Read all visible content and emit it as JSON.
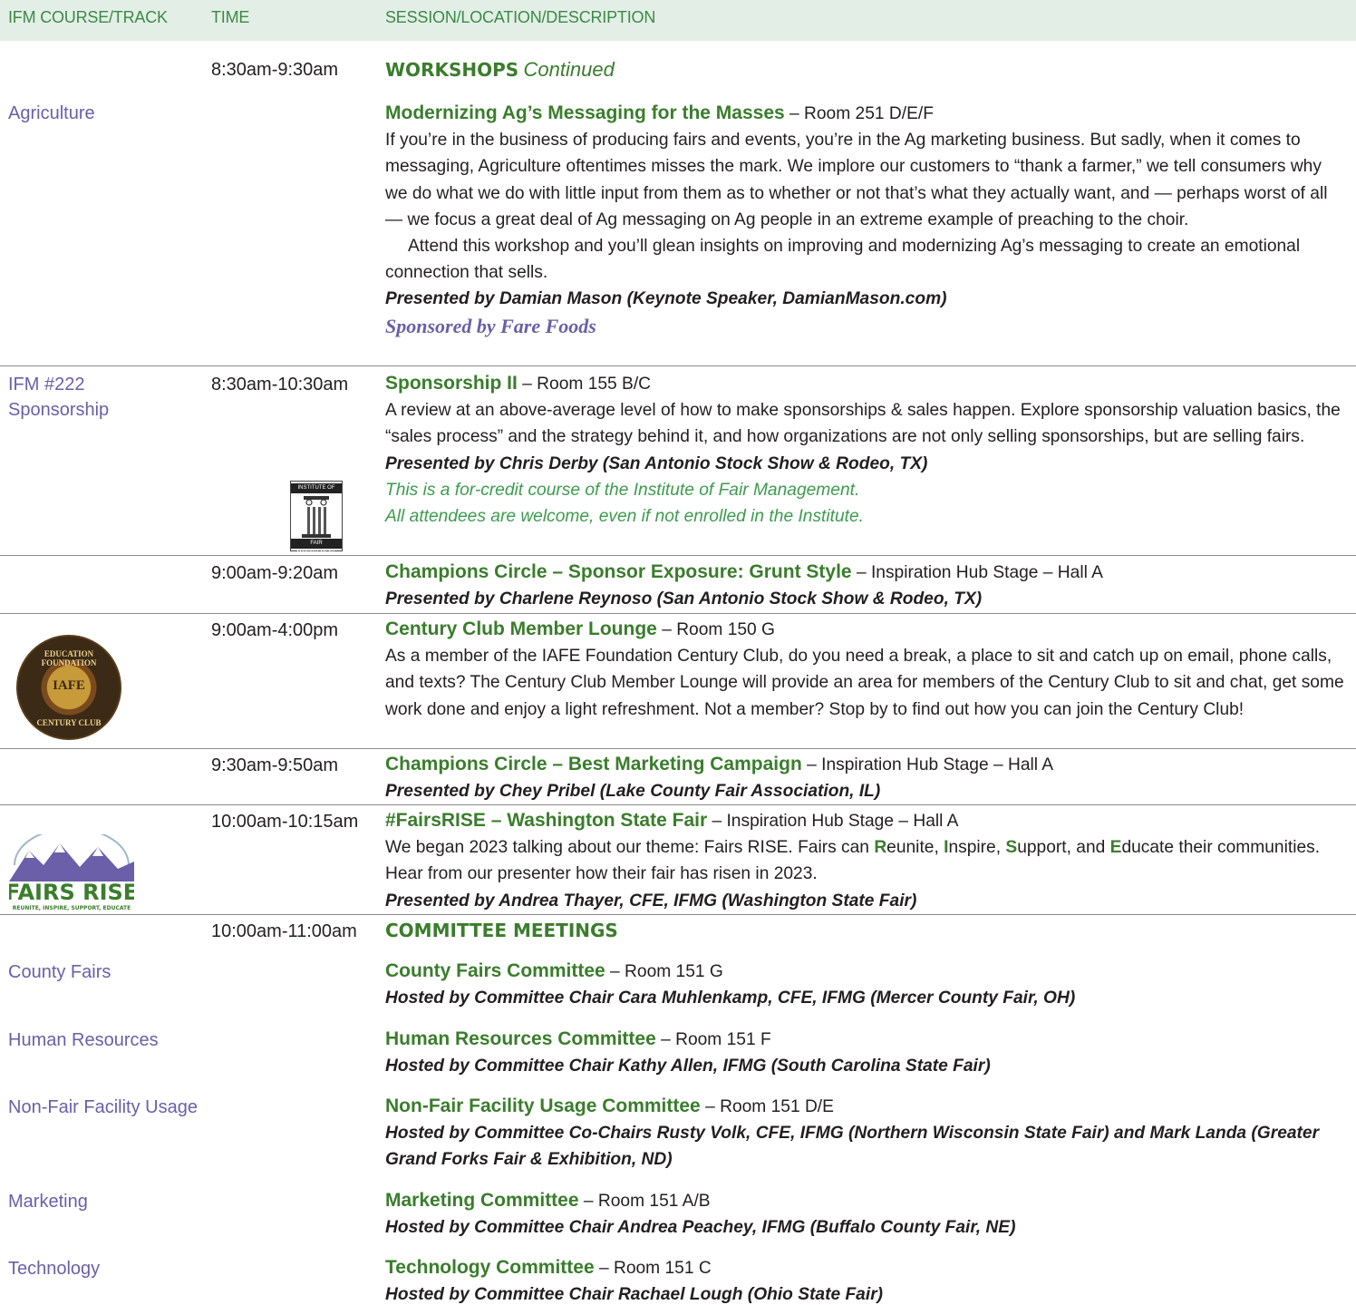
{
  "header": {
    "col1": "IFM COURSE/TRACK",
    "col2": "TIME",
    "col3": "SESSION/LOCATION/DESCRIPTION"
  },
  "workshops": {
    "time": "8:30am-9:30am",
    "heading": "WORKSHOPS",
    "heading_cont": "Continued",
    "track": "Agriculture",
    "title": "Modernizing Ag’s Messaging for the Masses",
    "location": " – Room 251 D/E/F",
    "body1": "If you’re in the business of producing fairs and events, you’re in the Ag marketing business. But sadly, when it comes to messaging, Agriculture oftentimes misses the mark. We implore our customers to “thank a farmer,” we tell consumers why we do what we do with little input from them as to whether or not that’s what they actually want, and — perhaps worst of all — we focus a great deal of Ag messaging on Ag people in an extreme example of preaching to the choir.",
    "body2": "Attend this workshop and you’ll glean insights on improving and modernizing Ag’s messaging to create an emotional connection that sells.",
    "presenter": "Presented by Damian Mason (Keynote Speaker, DamianMason.com)",
    "sponsor": "Sponsored by Fare Foods"
  },
  "sponsorship": {
    "track1": "IFM #222",
    "track2": "Sponsorship",
    "time": "8:30am-10:30am",
    "title": "Sponsorship II",
    "location": " – Room 155 B/C",
    "body": "A review at an above-average level of how to make sponsorships & sales happen. Explore sponsorship valuation basics, the “sales process” and the strategy behind it, and how organizations are not only selling sponsorships, but are selling fairs.",
    "presenter": "Presented by Chris Derby (San Antonio Stock Show & Rodeo, TX)",
    "credit1": "This is a for-credit course of the Institute of Fair Management.",
    "credit2": "All attendees are welcome, even if not enrolled in the Institute.",
    "logo_top": "INSTITUTE OF",
    "logo_bottom": "FAIR MANAGEMENT"
  },
  "grunt": {
    "time": "9:00am-9:20am",
    "title": "Champions Circle – Sponsor Exposure: Grunt Style",
    "location": " – Inspiration Hub Stage – Hall A",
    "presenter": "Presented by Charlene Reynoso (San Antonio Stock Show & Rodeo, TX)"
  },
  "century": {
    "time": "9:00am-4:00pm",
    "title": "Century Club Member Lounge",
    "location": " – Room 150 G",
    "body": "As a member of the IAFE Foundation Century Club, do you need a break, a place to sit and catch up on email, phone calls, and texts? The Century Club Member Lounge will provide an area for members of the Century Club to sit and chat, get some work done and enjoy a light refreshment. Not a member? Stop by to find out how you can join the Century Club!",
    "logo_top": "EDUCATION FOUNDATION",
    "logo_mid": "IAFE",
    "logo_bottom": "CENTURY CLUB"
  },
  "marketing_campaign": {
    "time": "9:30am-9:50am",
    "title": "Champions Circle – Best Marketing Campaign",
    "location": " – Inspiration Hub Stage – Hall A",
    "presenter": "Presented by Chey Pribel (Lake County Fair Association, IL)"
  },
  "fairsrise": {
    "time": "10:00am-10:15am",
    "title": "#FairsRISE – Washington State Fair",
    "location": " – Inspiration Hub Stage – Hall A",
    "body_a": "We began 2023 talking about our theme: Fairs RISE. Fairs can ",
    "r": "R",
    "r_rest": "eunite, ",
    "i": "I",
    "i_rest": "nspire, ",
    "s": "S",
    "s_rest": "upport, and ",
    "e": "E",
    "e_rest": "ducate their communities. Hear from our presenter how their fair has risen in 2023.",
    "presenter": "Presented by Andrea Thayer, CFE, IFMG (Washington State Fair)",
    "logo_text": "FAIRS RISE",
    "logo_sub": "REUNITE, INSPIRE, SUPPORT, EDUCATE"
  },
  "committees": {
    "time": "10:00am-11:00am",
    "heading": "COMMITTEE MEETINGS",
    "items": [
      {
        "track": "County Fairs",
        "title": "County Fairs Committee",
        "location": " – Room 151 G",
        "host": "Hosted by Committee Chair Cara Muhlenkamp, CFE, IFMG (Mercer County Fair, OH)"
      },
      {
        "track": "Human Resources",
        "title": "Human Resources Committee",
        "location": " – Room 151 F",
        "host": "Hosted by Committee Chair Kathy Allen, IFMG (South Carolina State Fair)"
      },
      {
        "track": "Non-Fair Facility Usage",
        "title": "Non-Fair Facility Usage Committee",
        "location": " – Room 151 D/E",
        "host": "Hosted by Committee Co-Chairs Rusty Volk, CFE, IFMG (Northern Wisconsin State Fair) and Mark Landa (Greater Grand Forks Fair & Exhibition, ND)"
      },
      {
        "track": "Marketing",
        "title": "Marketing Committee",
        "location": " – Room 151 A/B",
        "host": "Hosted by Committee Chair Andrea Peachey, IFMG (Buffalo County Fair, NE)"
      },
      {
        "track": "Technology",
        "title": "Technology Committee",
        "location": " – Room 151 C",
        "host": "Hosted by Committee Chair Rachael Lough (Ohio State Fair)"
      }
    ]
  }
}
